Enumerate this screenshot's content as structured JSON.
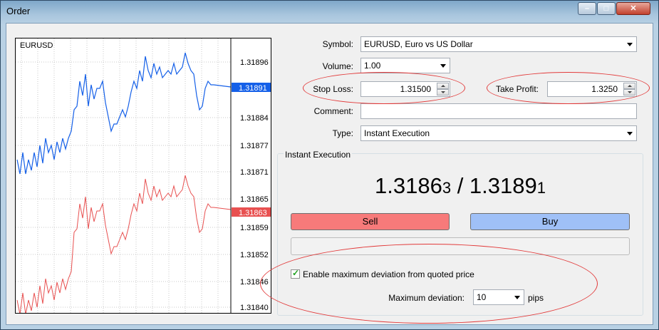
{
  "window": {
    "title": "Order"
  },
  "chart": {
    "symbol": "EURUSD",
    "price_labels": [
      "1.31896",
      "1.31891",
      "1.31884",
      "1.31877",
      "1.31871",
      "1.31865",
      "1.31863",
      "1.31859",
      "1.31852",
      "1.31846",
      "1.31840"
    ],
    "ask_tag": "1.31891",
    "bid_tag": "1.31863",
    "ask_color": "#1560e8",
    "bid_color": "#e85050"
  },
  "form": {
    "symbol_label": "Symbol:",
    "symbol_value": "EURUSD, Euro vs US Dollar",
    "volume_label": "Volume:",
    "volume_value": "1.00",
    "stoploss_label": "Stop Loss:",
    "stoploss_value": "1.31500",
    "takeprofit_label": "Take Profit:",
    "takeprofit_value": "1.3250",
    "comment_label": "Comment:",
    "comment_value": "",
    "type_label": "Type:",
    "type_value": "Instant Execution"
  },
  "execution": {
    "group_title": "Instant Execution",
    "bid_main": "1.3186",
    "bid_last": "3",
    "separator": " / ",
    "ask_main": "1.3189",
    "ask_last": "1",
    "sell_label": "Sell",
    "buy_label": "Buy",
    "sell_color": "#f77a7a",
    "buy_color": "#9fc0f7",
    "deviation_checkbox_label": "Enable maximum deviation from quoted price",
    "deviation_checked": true,
    "max_deviation_label": "Maximum deviation:",
    "max_deviation_value": "10",
    "units": "pips"
  },
  "highlight_color": "#e23a3a"
}
